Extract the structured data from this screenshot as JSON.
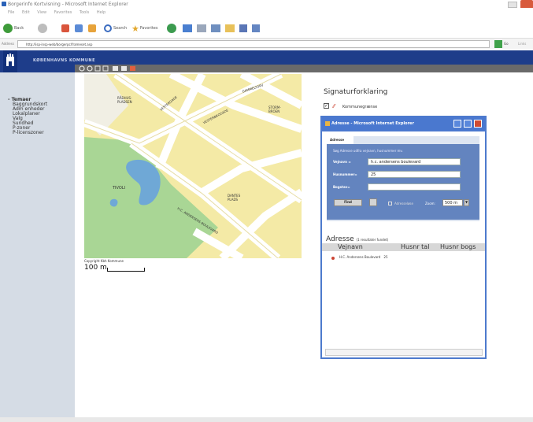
{
  "browser": {
    "title": "Borgerinfo Kortvisning - Microsoft Internet Explorer",
    "menu": [
      "File",
      "Edit",
      "View",
      "Favorites",
      "Tools",
      "Help"
    ],
    "toolbar": {
      "back": "Back",
      "search": "Search",
      "favorites": "Favorites"
    },
    "address_label": "Address",
    "address": "http://isp-insp-web/borgerpc/frameset.asp",
    "go": "Go",
    "links": "Links"
  },
  "site": {
    "title": "KØBENHAVNS KOMMUNE"
  },
  "sidebar": {
    "heading": "- Temaer",
    "items": [
      "Baggrundskort",
      "Adm enheder",
      "Lokalplaner",
      "Valg",
      "Sundhed",
      "P-zoner",
      "P-licenszoner"
    ]
  },
  "map": {
    "labels": [
      "RÅDHUS-\nPLADSEN",
      "STORM-\nBROEN",
      "TIVOLI",
      "DANTES\nPLADS",
      "H.C. ANDERSENS BOULEVARD",
      "VESTERBROGADE",
      "VESTERGADE",
      "GAMMELTORV"
    ],
    "copyright": "Copyright Kbh Kommune",
    "scale": "100 m"
  },
  "legend": {
    "title": "Signaturforklaring",
    "item": "Kommunegrænse"
  },
  "popup": {
    "title": "Adresse - Microsoft Internet Explorer",
    "tab": "Adresse",
    "hint": "Søg Adresse udfra vejnavn, husnummer mv.",
    "fields": {
      "street_label": "Vejnavn =",
      "street_value": "h.c. andersens boulevard",
      "number_label": "Husnummer=",
      "number_value": "25",
      "letter_label": "Bogstav=",
      "letter_value": ""
    },
    "find": "Find",
    "admin_label": "Adresseløse",
    "zoom_label": "Zoom:",
    "zoom_value": "500 m",
    "results_title": "Adresse",
    "results_count": "(1 resultater fundet)",
    "columns": [
      "Vejnavn",
      "Husnr tal",
      "Husnr bogs"
    ],
    "rows": [
      {
        "street": "H.C. Andersens Boulevard",
        "number": "25"
      }
    ]
  }
}
